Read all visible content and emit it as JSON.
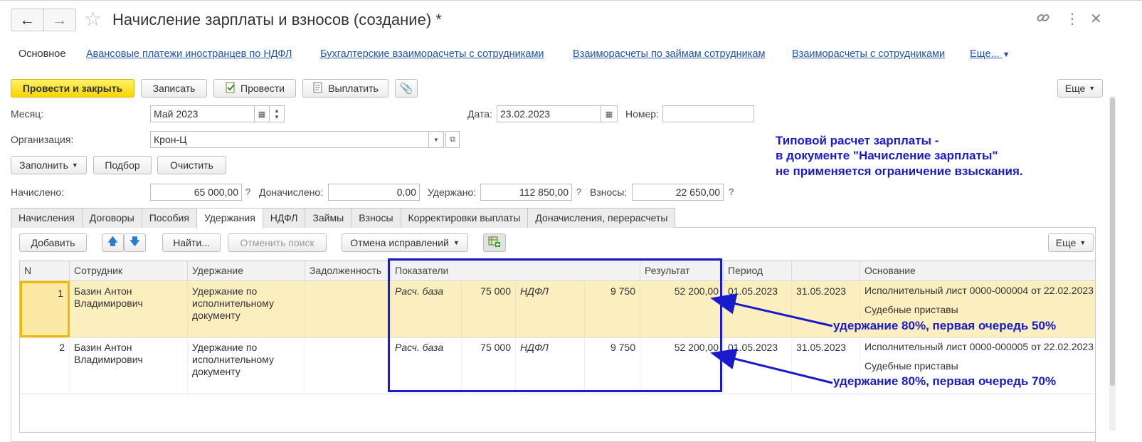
{
  "window": {
    "title": "Начисление зарплаты и взносов (создание) *",
    "nav_back_icon": "arrow-left-icon",
    "nav_fwd_icon": "arrow-right-icon",
    "favorite_icon": "star-icon",
    "link_icon": "link-icon",
    "more_icon": "vertical-dots-icon",
    "close_icon": "close-icon"
  },
  "sections": {
    "main": "Основное",
    "link1": "Авансовые платежи иностранцев по НДФЛ",
    "link2": "Бухгалтерские взаиморасчеты с сотрудниками",
    "link3": "Взаиморасчеты по займам сотрудникам",
    "link4": "Взаиморасчеты с сотрудниками",
    "more": "Еще..."
  },
  "toolbar": {
    "post_close": "Провести и закрыть",
    "save": "Записать",
    "post": "Провести",
    "pay": "Выплатить",
    "more": "Еще"
  },
  "form": {
    "month_label": "Месяц:",
    "month_value": "Май 2023",
    "date_label": "Дата:",
    "date_value": "23.02.2023",
    "number_label": "Номер:",
    "number_value": "",
    "org_label": "Организация:",
    "org_value": "Крон-Ц",
    "fill": "Заполнить",
    "select": "Подбор",
    "clear": "Очистить",
    "accrued_label": "Начислено:",
    "accrued_value": "65 000,00",
    "additional_label": "Доначислено:",
    "additional_value": "0,00",
    "withheld_label": "Удержано:",
    "withheld_value": "112 850,00",
    "contrib_label": "Взносы:",
    "contrib_value": "22 650,00",
    "help_mark": "?"
  },
  "annotation_top": {
    "line1": "Типовой расчет зарплаты -",
    "line2": "в документе \"Начисление зарплаты\"",
    "line3": "не применяется ограничение взыскания."
  },
  "tabs": [
    "Начисления",
    "Договоры",
    "Пособия",
    "Удержания",
    "НДФЛ",
    "Займы",
    "Взносы",
    "Корректировки выплаты",
    "Доначисления, перерасчеты"
  ],
  "table_toolbar": {
    "add": "Добавить",
    "find": "Найти...",
    "cancel_search": "Отменить поиск",
    "cancel_corrections": "Отмена исправлений",
    "more": "Еще"
  },
  "table": {
    "headers": {
      "n": "N",
      "employee": "Сотрудник",
      "deduction": "Удержание",
      "debt": "Задолженность",
      "indicators": "Показатели",
      "result": "Результат",
      "period": "Период",
      "period_end": "",
      "basis": "Основание"
    },
    "rows": [
      {
        "n": "1",
        "employee": "Базин Антон Владимирович",
        "deduction": "Удержание по исполнительному документу",
        "debt": "",
        "ind1_name": "Расч. база",
        "ind1_value": "75 000",
        "ind2_name": "НДФЛ",
        "ind2_value": "9 750",
        "result": "52 200,00",
        "period_from": "01.05.2023",
        "period_to": "31.05.2023",
        "basis": "Исполнительный лист 0000-000004 от 22.02.2023",
        "basis2": "Судебные приставы"
      },
      {
        "n": "2",
        "employee": "Базин Антон Владимирович",
        "deduction": "Удержание по исполнительному документу",
        "debt": "",
        "ind1_name": "Расч. база",
        "ind1_value": "75 000",
        "ind2_name": "НДФЛ",
        "ind2_value": "9 750",
        "result": "52 200,00",
        "period_from": "01.05.2023",
        "period_to": "31.05.2023",
        "basis": "Исполнительный лист 0000-000005 от 22.02.2023",
        "basis2": "Судебные приставы"
      }
    ]
  },
  "annotations": {
    "row1": "удержание 80%, первая очередь 50%",
    "row2": "удержание 80%, первая очередь 70%",
    "color": "#1a1acd"
  }
}
